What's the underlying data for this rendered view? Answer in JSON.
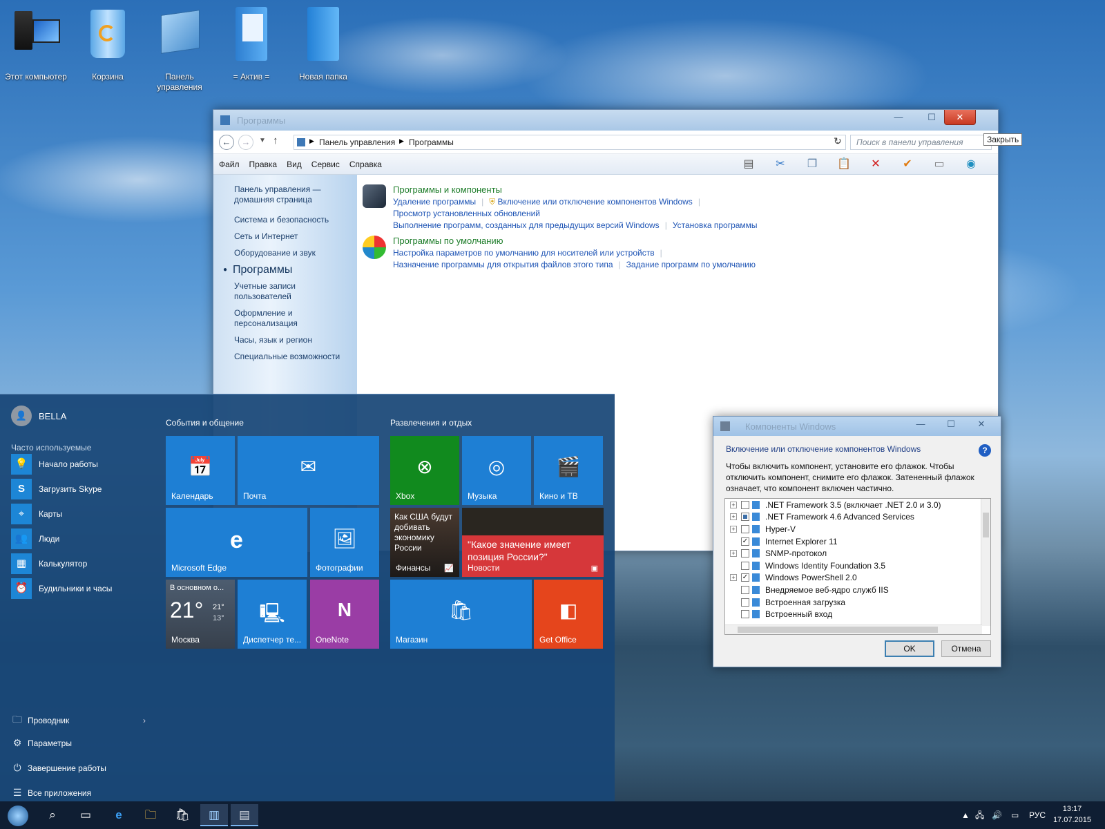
{
  "desktop": {
    "icons": [
      {
        "label": "Этот компьютер"
      },
      {
        "label": "Корзина"
      },
      {
        "label": "Панель управления"
      },
      {
        "label": "= Актив ="
      },
      {
        "label": "Новая папка"
      }
    ]
  },
  "control_panel": {
    "title": "Программы",
    "breadcrumb": [
      "Панель управления",
      "Программы"
    ],
    "search_placeholder": "Поиск в панели управления",
    "menu": [
      "Файл",
      "Правка",
      "Вид",
      "Сервис",
      "Справка"
    ],
    "sidebar": {
      "home": "Панель управления — домашняя страница",
      "items": [
        "Система и безопасность",
        "Сеть и Интернет",
        "Оборудование и звук"
      ],
      "current": "Программы",
      "items2": [
        "Учетные записи пользователей",
        "Оформление и персонализация",
        "Часы, язык и регион",
        "Специальные возможности"
      ]
    },
    "groups": [
      {
        "title": "Программы и компоненты",
        "links": [
          "Удаление программы",
          "Включение или отключение компонентов Windows",
          "Просмотр установленных обновлений",
          "Выполнение программ, созданных для предыдущих версий Windows",
          "Установка программы"
        ]
      },
      {
        "title": "Программы по умолчанию",
        "links": [
          "Настройка параметров по умолчанию для носителей или устройств",
          "Назначение программы для открытия файлов этого типа",
          "Задание программ по умолчанию"
        ]
      }
    ],
    "close_tooltip": "Закрыть"
  },
  "start_menu": {
    "user": "BELLA",
    "frequent_header": "Часто используемые",
    "apps": [
      "Начало работы",
      "Загрузить Skype",
      "Карты",
      "Люди",
      "Калькулятор",
      "Будильники и часы"
    ],
    "bottom": [
      "Проводник",
      "Параметры",
      "Завершение работы",
      "Все приложения"
    ],
    "group1": "События и общение",
    "group2": "Развлечения и отдых",
    "tiles": {
      "calendar": "Календарь",
      "mail": "Почта",
      "edge": "Microsoft Edge",
      "photos": "Фотографии",
      "weather_head": "В основном о...",
      "weather_temp": "21°",
      "weather_hi": "21°",
      "weather_lo": "13°",
      "weather_city": "Москва",
      "device": "Диспетчер те...",
      "onenote": "OneNote",
      "xbox": "Xbox",
      "music": "Музыка",
      "movies": "Кино и ТВ",
      "finance_text": "Как США будут добивать экономику России",
      "finance": "Финансы",
      "news_text": "\"Какое значение имеет позиция России?\"",
      "news": "Новости",
      "store": "Магазин",
      "office": "Get Office"
    }
  },
  "components_dialog": {
    "title": "Компоненты Windows",
    "header": "Включение или отключение компонентов Windows",
    "description": "Чтобы включить компонент, установите его флажок. Чтобы отключить компонент, снимите его флажок. Затененный флажок означает, что компонент включен частично.",
    "items": [
      {
        "name": ".NET Framework 3.5 (включает .NET 2.0 и 3.0)",
        "expand": true,
        "state": "off"
      },
      {
        "name": ".NET Framework 4.6 Advanced Services",
        "expand": true,
        "state": "partial"
      },
      {
        "name": "Hyper-V",
        "expand": true,
        "state": "off"
      },
      {
        "name": "Internet Explorer 11",
        "expand": false,
        "state": "on"
      },
      {
        "name": "SNMP-протокол",
        "expand": true,
        "state": "off"
      },
      {
        "name": "Windows Identity Foundation 3.5",
        "expand": false,
        "state": "off"
      },
      {
        "name": "Windows PowerShell 2.0",
        "expand": true,
        "state": "on"
      },
      {
        "name": "Внедряемое веб-ядро служб IIS",
        "expand": false,
        "state": "off"
      },
      {
        "name": "Встроенная загрузка",
        "expand": false,
        "state": "off"
      },
      {
        "name": "Встроенный вход",
        "expand": false,
        "state": "off"
      }
    ],
    "ok": "OK",
    "cancel": "Отмена"
  },
  "taskbar": {
    "lang": "РУС",
    "time": "13:17",
    "date": "17.07.2015"
  }
}
